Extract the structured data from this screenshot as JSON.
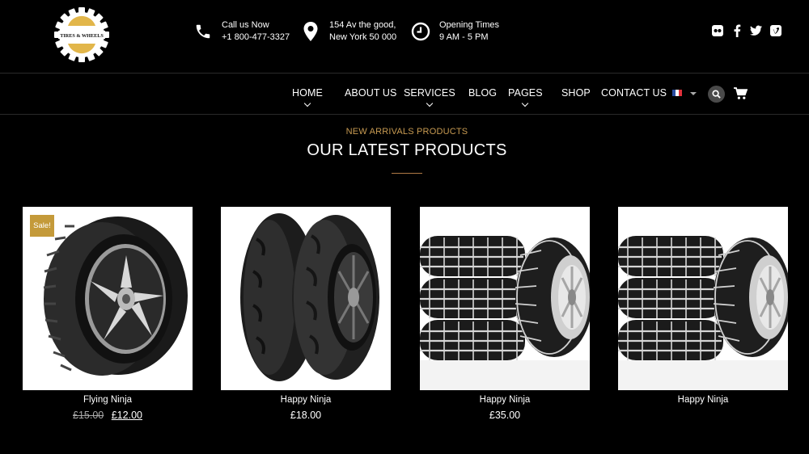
{
  "brand": {
    "logo_text": "TIRES & WHEELS",
    "accent_color": "#c89b52",
    "logo_band_color": "#e2b64a"
  },
  "contact": {
    "phone_label": "Call us Now",
    "phone_value": "+1 800-477-3327",
    "address_line1": "154 Av the good,",
    "address_line2": "New York 50 000",
    "hours_label": "Opening Times",
    "hours_value": "9 AM - 5 PM"
  },
  "social": [
    "flickr-icon",
    "facebook-icon",
    "twitter-icon",
    "vimeo-icon"
  ],
  "nav": {
    "items": [
      {
        "label": "HOME",
        "has_dropdown": true
      },
      {
        "label": "ABOUT US",
        "has_dropdown": false
      },
      {
        "label": "SERVICES",
        "has_dropdown": true
      },
      {
        "label": "BLOG",
        "has_dropdown": false
      },
      {
        "label": "PAGES",
        "has_dropdown": true
      },
      {
        "label": "SHOP",
        "has_dropdown": false
      },
      {
        "label": "CONTACT US",
        "has_dropdown": false
      }
    ],
    "language": "french-flag-icon"
  },
  "section": {
    "eyebrow": "NEW ARRIVALS PRODUCTS",
    "title": "OUR LATEST PRODUCTS"
  },
  "products": [
    {
      "name": "Flying Ninja",
      "old_price": "£15.00",
      "price": "£12.00",
      "badge": "Sale!",
      "image": "car-tire-icon"
    },
    {
      "name": "Happy Ninja",
      "old_price": "",
      "price": "£18.00",
      "badge": "",
      "image": "motorcycle-tires-icon"
    },
    {
      "name": "Happy Ninja",
      "old_price": "",
      "price": "£35.00",
      "badge": "",
      "image": "winter-tires-stack-icon"
    },
    {
      "name": "Happy Ninja",
      "old_price": "",
      "price": "",
      "badge": "",
      "image": "winter-tires-stack-icon"
    }
  ]
}
